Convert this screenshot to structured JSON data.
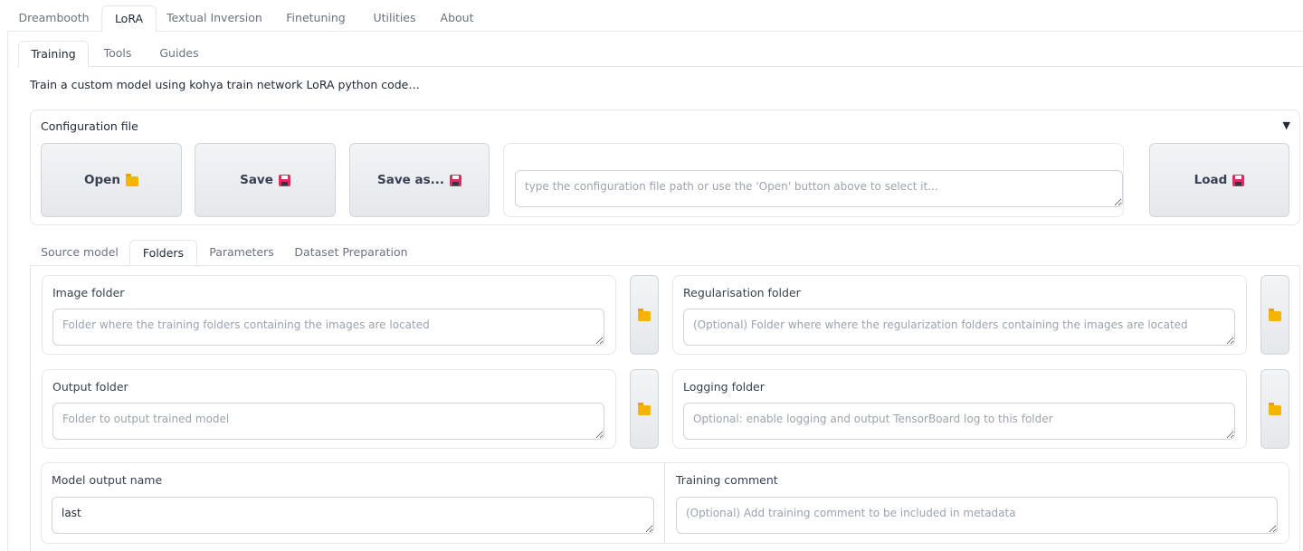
{
  "top_tabs": [
    "Dreambooth",
    "LoRA",
    "Textual Inversion",
    "Finetuning",
    "Utilities",
    "About"
  ],
  "sub_tabs": [
    "Training",
    "Tools",
    "Guides"
  ],
  "description": "Train a custom model using kohya train network LoRA python code…",
  "config": {
    "title": "Configuration file",
    "collapse_glyph": "▼",
    "open_label": "Open",
    "save_label": "Save",
    "save_as_label": "Save as...",
    "load_label": "Load",
    "path_placeholder": "type the configuration file path or use the 'Open' button above to select it..."
  },
  "section_tabs": [
    "Source model",
    "Folders",
    "Parameters",
    "Dataset Preparation"
  ],
  "folders": {
    "image_folder": {
      "label": "Image folder",
      "placeholder": "Folder where the training folders containing the images are located",
      "value": ""
    },
    "reg_folder": {
      "label": "Regularisation folder",
      "placeholder": "(Optional) Folder where where the regularization folders containing the images are located",
      "value": ""
    },
    "output_folder": {
      "label": "Output folder",
      "placeholder": "Folder to output trained model",
      "value": ""
    },
    "logging_folder": {
      "label": "Logging folder",
      "placeholder": "Optional: enable logging and output TensorBoard log to this folder",
      "value": ""
    },
    "model_output_name": {
      "label": "Model output name",
      "placeholder": "",
      "value": "last"
    },
    "training_comment": {
      "label": "Training comment",
      "placeholder": "(Optional) Add training comment to be included in metadata",
      "value": ""
    }
  },
  "icons": {
    "folder": "folder-icon",
    "save": "floppy-disk-icon"
  },
  "colors": {
    "folder": "#f4b400",
    "floppy": "#d6305f"
  }
}
